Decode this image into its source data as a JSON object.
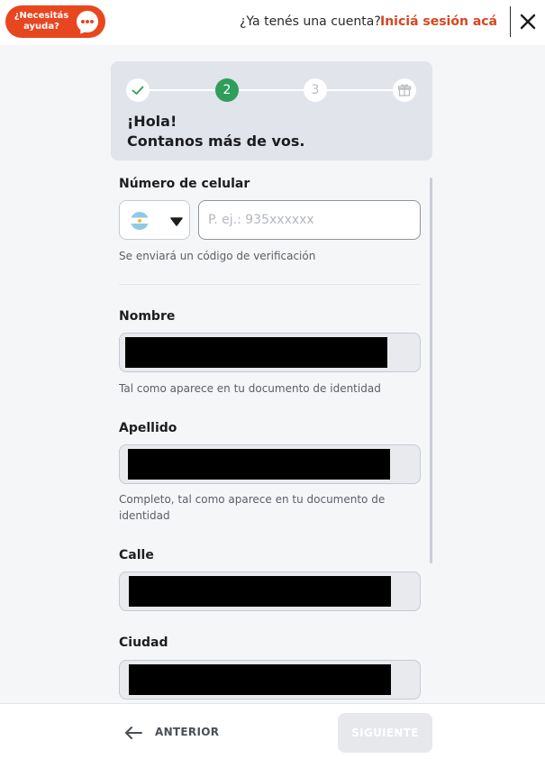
{
  "header": {
    "help_label": "¿Necesitás ayuda?",
    "account_question": "¿Ya tenés una cuenta?",
    "login_link": "Iniciá sesión acá",
    "colors": {
      "accent": "#e8461f",
      "link": "#d9451e"
    }
  },
  "stepper": {
    "steps": [
      {
        "label": "",
        "state": "completed",
        "icon": "check-icon"
      },
      {
        "label": "2",
        "state": "current"
      },
      {
        "label": "3",
        "state": "upcoming"
      },
      {
        "label": "",
        "state": "upcoming",
        "icon": "gift-icon"
      }
    ],
    "greeting_line1": "¡Hola!",
    "greeting_line2": "Contanos más de vos.",
    "colors": {
      "current": "#2f9e5b",
      "completed": "#2f9e5b"
    }
  },
  "form": {
    "phone": {
      "label": "Número de celular",
      "country_flag": "argentina-flag-icon",
      "placeholder": "P. ej.: 935xxxxxx",
      "value": "",
      "hint": "Se enviará un código de verificación"
    },
    "first_name": {
      "label": "Nombre",
      "hint": "Tal como aparece en tu documento de identidad"
    },
    "last_name": {
      "label": "Apellido",
      "hint": "Completo, tal como aparece en tu documento de identidad"
    },
    "street": {
      "label": "Calle"
    },
    "city": {
      "label": "Ciudad"
    }
  },
  "footer": {
    "back_label": "ANTERIOR",
    "next_label": "SIGUIENTE"
  }
}
